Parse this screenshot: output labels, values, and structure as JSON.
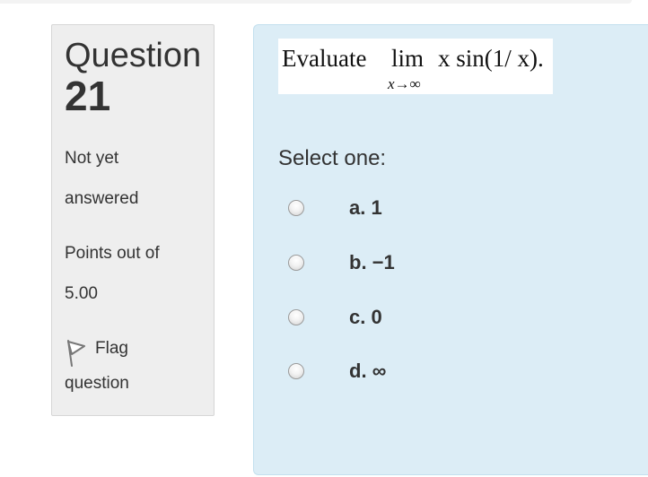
{
  "info": {
    "question_word": "Question",
    "question_number": "21",
    "status_line1": "Not yet",
    "status_line2": "answered",
    "points_line1": "Points out of",
    "points_line2": "5.00",
    "flag_line1": "Flag",
    "flag_line2": "question",
    "flag_icon": "flag-icon"
  },
  "question": {
    "formula": {
      "evaluate": "Evaluate",
      "lim": "lim",
      "expression": "x sin(1/ x).",
      "subscript": "x→∞"
    },
    "prompt": "Select one:",
    "options": [
      {
        "label": "a. 1",
        "selected": false
      },
      {
        "label": "b. −1",
        "selected": false
      },
      {
        "label": "c. 0",
        "selected": false
      },
      {
        "label": "d. ∞",
        "selected": false
      }
    ]
  },
  "colors": {
    "info_background": "#eeeeee",
    "content_background": "#dcedf6",
    "text": "#333333"
  }
}
